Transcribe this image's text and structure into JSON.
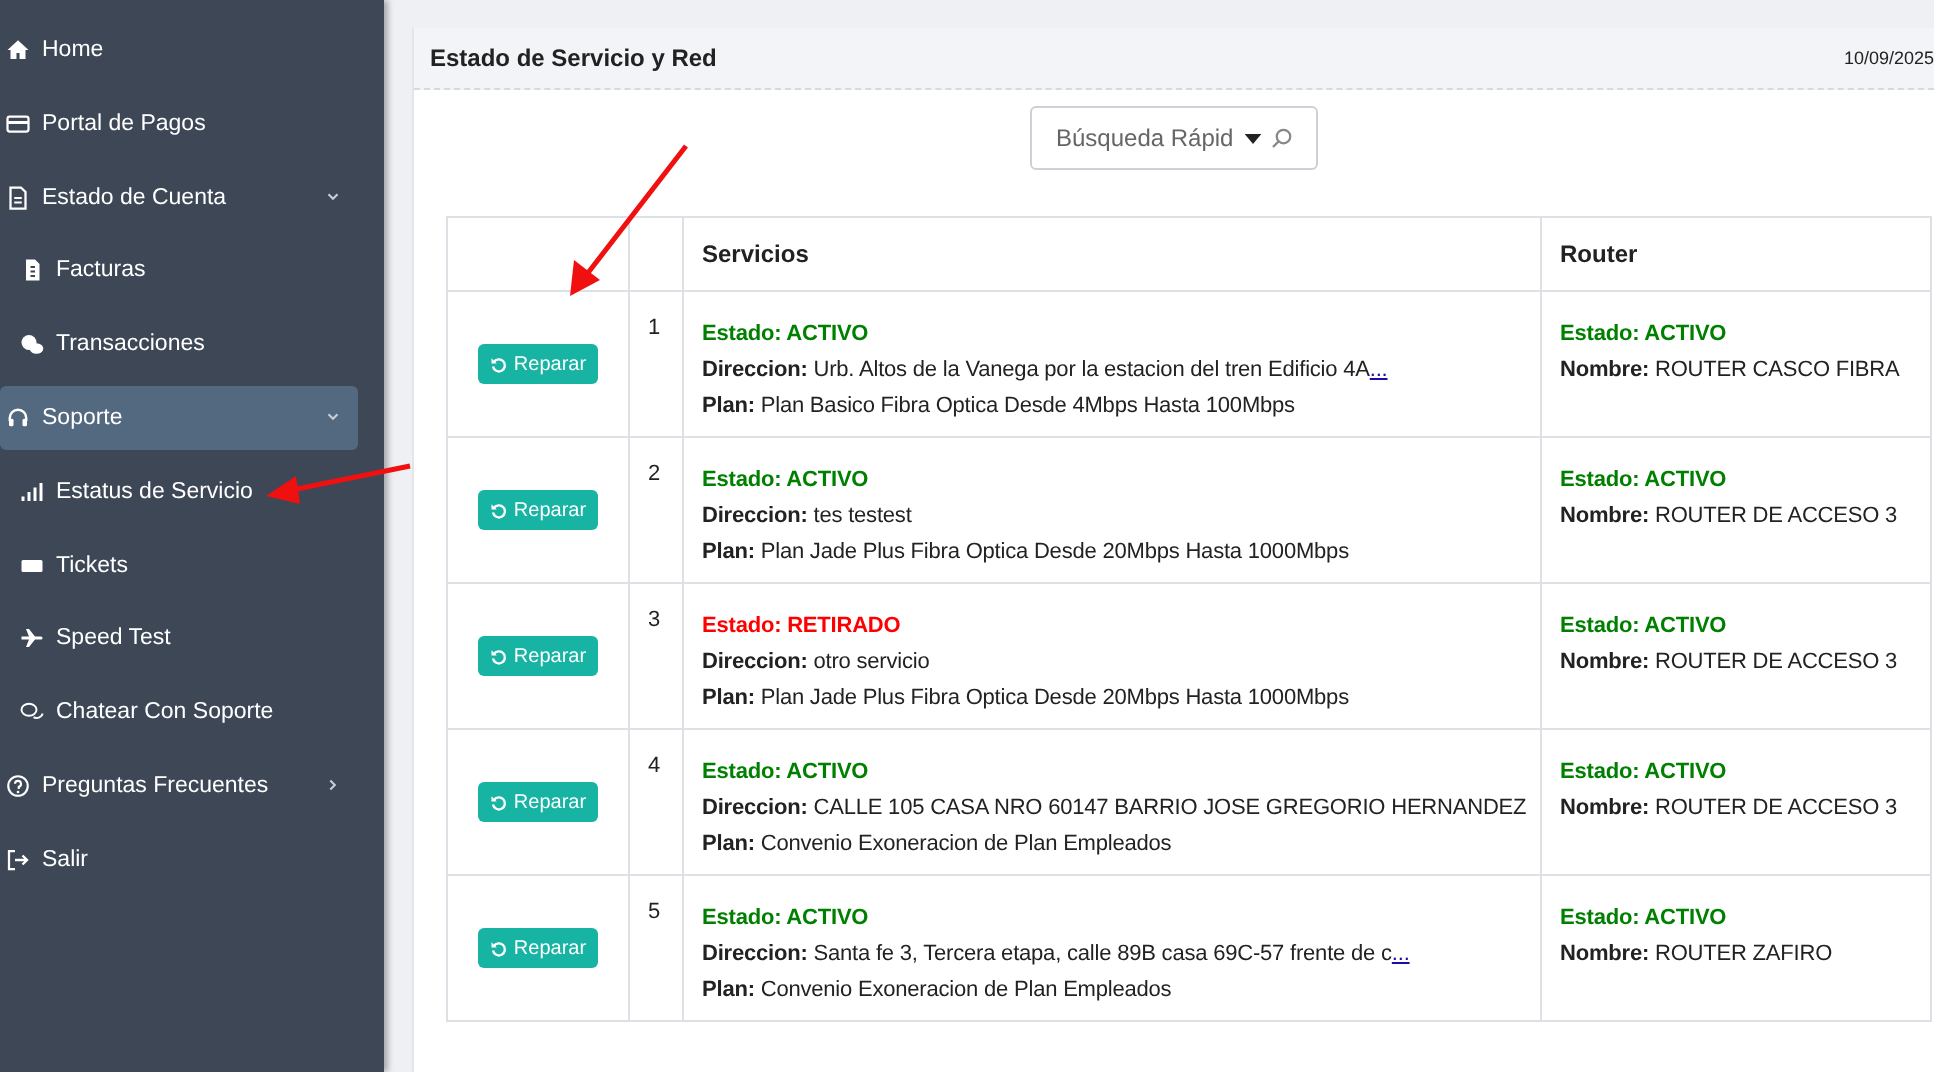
{
  "sidebar": {
    "items": [
      {
        "label": "Home",
        "selected": false
      },
      {
        "label": "Portal de Pagos",
        "selected": false
      },
      {
        "label": "Estado de Cuenta",
        "selected": false,
        "expanded": true,
        "children": [
          {
            "label": "Facturas",
            "selected": false
          },
          {
            "label": "Transacciones",
            "selected": false
          }
        ]
      },
      {
        "label": "Soporte",
        "selected": true,
        "expanded": true,
        "children": [
          {
            "label": "Estatus de Servicio",
            "selected": false
          },
          {
            "label": "Tickets",
            "selected": false
          },
          {
            "label": "Speed Test",
            "selected": false
          },
          {
            "label": "Chatear Con Soporte",
            "selected": false
          }
        ]
      },
      {
        "label": "Preguntas Frecuentes",
        "selected": false,
        "expanded": false
      },
      {
        "label": "Salir",
        "selected": false
      }
    ]
  },
  "panel": {
    "title": "Estado de Servicio y Red",
    "date": "10/09/2025"
  },
  "search": {
    "placeholder": "Búsqueda Rápid"
  },
  "table": {
    "columns": [
      "Servicios",
      "Router"
    ],
    "rows": [
      {
        "button": "Reparar",
        "number": "1",
        "estado": {
          "text": "Estado: ACTIVO",
          "color": "#008000"
        },
        "direccion": "**Direccion:** Urb. Altos de la Vanega por la estacion del tren Edificio 4A",
        "more_link": "...",
        "plan": "**Plan:** Plan Basico Fibra Optica Desde 4Mbps Hasta 100Mbps",
        "router_estado": {
          "text": "Estado: ACTIVO",
          "color": "#008000"
        },
        "router_nombre": "**Nombre:** ROUTER CASCO FIBRA"
      },
      {
        "button": "Reparar",
        "number": "2",
        "estado": {
          "text": "Estado: ACTIVO",
          "color": "#008000"
        },
        "direccion": "**Direccion:** tes testest",
        "plan": "**Plan:** Plan Jade Plus Fibra Optica Desde 20Mbps Hasta 1000Mbps",
        "router_estado": {
          "text": "Estado: ACTIVO",
          "color": "#008000"
        },
        "router_nombre": "**Nombre:** ROUTER DE ACCESO 3"
      },
      {
        "button": "Reparar",
        "number": "3",
        "estado": {
          "text": "Estado: RETIRADO",
          "color": "#ff0000"
        },
        "direccion": "**Direccion:** otro servicio",
        "plan": "**Plan:** Plan Jade Plus Fibra Optica Desde 20Mbps Hasta 1000Mbps",
        "router_estado": {
          "text": "Estado: ACTIVO",
          "color": "#008000"
        },
        "router_nombre": "**Nombre:** ROUTER DE ACCESO 3"
      },
      {
        "button": "Reparar",
        "number": "4",
        "estado": {
          "text": "Estado: ACTIVO",
          "color": "#008000"
        },
        "direccion": "**Direccion:** CALLE 105 CASA NRO 60147 BARRIO JOSE GREGORIO HERNANDEZ",
        "plan": "**Plan:** Convenio Exoneracion de Plan Empleados",
        "router_estado": {
          "text": "Estado: ACTIVO",
          "color": "#008000"
        },
        "router_nombre": "**Nombre:** ROUTER DE ACCESO 3"
      },
      {
        "button": "Reparar",
        "number": "5",
        "estado": {
          "text": "Estado: ACTIVO",
          "color": "#008000"
        },
        "direccion": "**Direccion:** Santa fe 3, Tercera etapa, calle 89B casa 69C-57 frente de c",
        "more_link": "...",
        "plan": "**Plan:** Convenio Exoneracion de Plan Empleados",
        "router_estado": {
          "text": "Estado: ACTIVO",
          "color": "#008000"
        },
        "router_nombre": "**Nombre:** ROUTER ZAFIRO"
      }
    ]
  }
}
